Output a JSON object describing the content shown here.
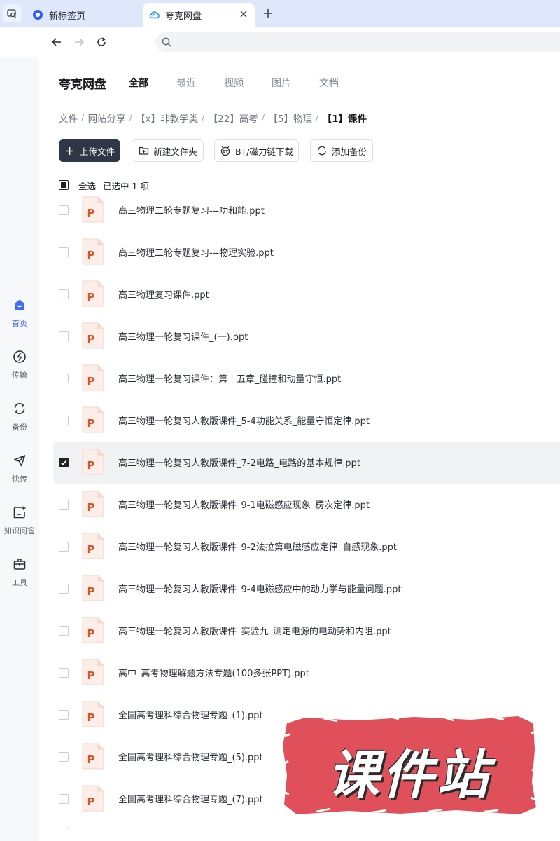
{
  "browser": {
    "tabs": [
      {
        "title": "新标签页",
        "icon": "browser-logo-icon",
        "active": false
      },
      {
        "title": "夸克网盘",
        "icon": "cloud-drive-icon",
        "active": true
      }
    ],
    "address_value": ""
  },
  "sidebar": {
    "items": [
      {
        "label": "首页",
        "icon": "home-icon",
        "active": true
      },
      {
        "label": "传输",
        "icon": "transfer-icon",
        "active": false
      },
      {
        "label": "备份",
        "icon": "backup-icon",
        "active": false
      },
      {
        "label": "快传",
        "icon": "send-icon",
        "active": false
      },
      {
        "label": "知识问答",
        "icon": "qa-icon",
        "active": false
      },
      {
        "label": "工具",
        "icon": "toolbox-icon",
        "active": false
      }
    ]
  },
  "header": {
    "brand": "夸克网盘",
    "tabs": [
      "全部",
      "最近",
      "视频",
      "图片",
      "文档"
    ],
    "active_tab": "全部"
  },
  "breadcrumb": [
    "文件",
    "网站分享",
    "【x】非教学类",
    "【22】高考",
    "【5】物理",
    "【1】课件"
  ],
  "actions": {
    "upload": "上传文件",
    "new_folder": "新建文件夹",
    "bt_download": "BT/磁力链下载",
    "add_backup": "添加备份"
  },
  "selection": {
    "select_all": "全选",
    "selected_text": "已选中  1  项"
  },
  "files": [
    {
      "name": "高三物理二轮专题复习---功和能.ppt",
      "checked": false
    },
    {
      "name": "高三物理二轮专题复习---物理实验.ppt",
      "checked": false
    },
    {
      "name": "高三物理复习课件.ppt",
      "checked": false
    },
    {
      "name": "高三物理一轮复习课件_(一).ppt",
      "checked": false
    },
    {
      "name": "高三物理一轮复习课件：第十五章_碰撞和动量守恒.ppt",
      "checked": false
    },
    {
      "name": "高三物理一轮复习人教版课件_5-4功能关系_能量守恒定律.ppt",
      "checked": false
    },
    {
      "name": "高三物理一轮复习人教版课件_7-2电路_电路的基本规律.ppt",
      "checked": true
    },
    {
      "name": "高三物理一轮复习人教版课件_9-1电磁感应现象_楞次定律.ppt",
      "checked": false
    },
    {
      "name": "高三物理一轮复习人教版课件_9-2法拉第电磁感应定律_自感现象.ppt",
      "checked": false
    },
    {
      "name": "高三物理一轮复习人教版课件_9-4电磁感应中的动力学与能量问题.ppt",
      "checked": false
    },
    {
      "name": "高三物理一轮复习人教版课件_实验九_测定电源的电动势和内阻.ppt",
      "checked": false
    },
    {
      "name": "高中_高考物理解题方法专题(100多张PPT).ppt",
      "checked": false
    },
    {
      "name": "全国高考理科综合物理专题_(1).ppt",
      "checked": false
    },
    {
      "name": "全国高考理科综合物理专题_(5).ppt",
      "checked": false
    },
    {
      "name": "全国高考理科综合物理专题_(7).ppt",
      "checked": false
    }
  ],
  "watermark": {
    "text": "课件站"
  },
  "colors": {
    "accent": "#3f6dfb",
    "ppt_orange": "#d9552a",
    "stamp_red": "#e0505b",
    "primary_button": "#2f3747"
  }
}
